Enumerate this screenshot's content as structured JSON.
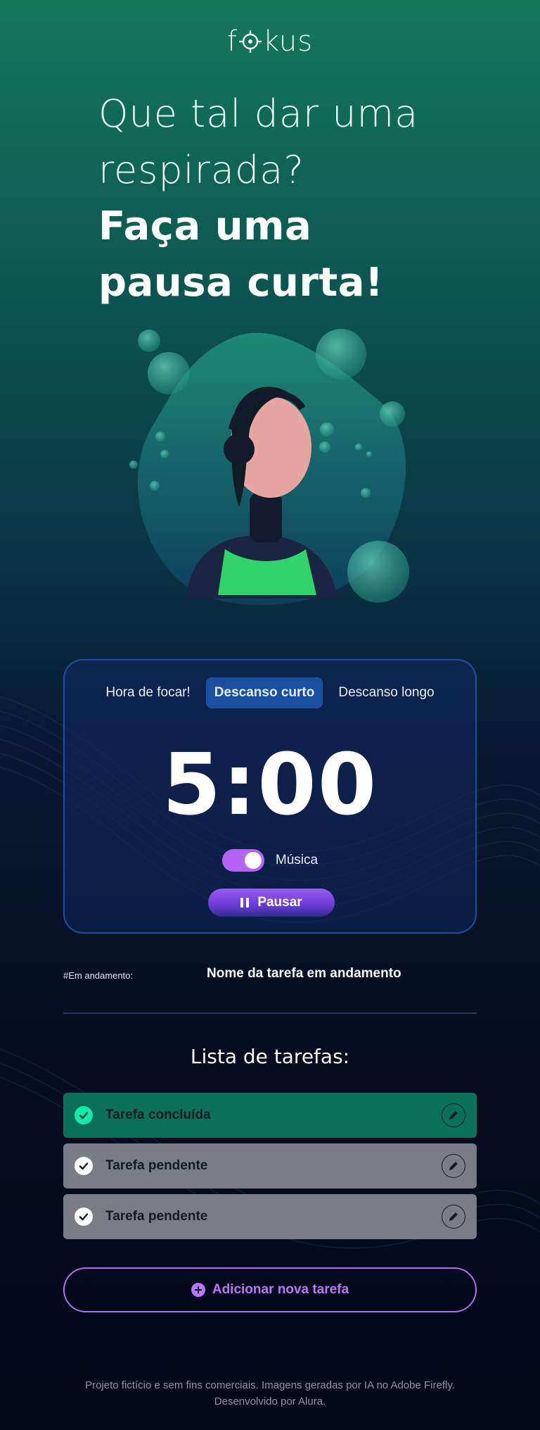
{
  "header": {
    "logo": "fokus"
  },
  "headline": {
    "line1": "Que tal dar uma",
    "line2": "respirada?",
    "bold1": "Faça uma",
    "bold2": "pausa curta!"
  },
  "timer": {
    "tabs": [
      {
        "label": "Hora de focar!",
        "active": false
      },
      {
        "label": "Descanso curto",
        "active": true
      },
      {
        "label": "Descanso longo",
        "active": false
      }
    ],
    "time": "5:00",
    "music_label": "Música",
    "music_on": true,
    "pause_label": "Pausar"
  },
  "in_progress": {
    "label": "#Em andamento:",
    "task_name": "Nome da tarefa em andamento"
  },
  "tasks": {
    "title": "Lista de tarefas:",
    "items": [
      {
        "label": "Tarefa concluída",
        "status": "done"
      },
      {
        "label": "Tarefa pendente",
        "status": "pending"
      },
      {
        "label": "Tarefa pendente",
        "status": "pending"
      }
    ],
    "add_label": "Adicionar nova tarefa"
  },
  "footer": {
    "line1": "Projeto fictício e sem fins comerciais. Imagens geradas por IA no Adobe Firefly.",
    "line2": "Desenvolvido por Alura."
  },
  "colors": {
    "accent_purple": "#b463f5",
    "done_green": "#0b705a",
    "check_green": "#13e9a8",
    "pending_gray": "#7a7d86",
    "card_border": "#1c4fa0"
  }
}
